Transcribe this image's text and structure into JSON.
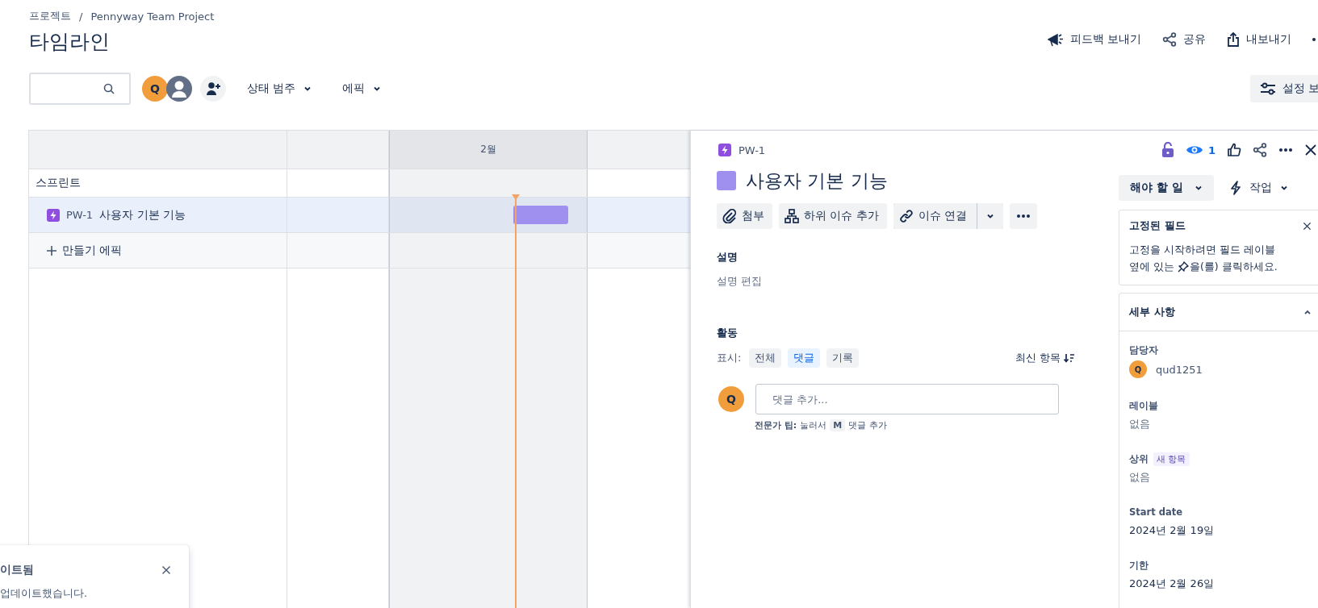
{
  "breadcrumb": {
    "items": [
      "프로젝트",
      "Pennyway Team Project"
    ],
    "separator": "/"
  },
  "page_title": "타임라인",
  "header_actions": [
    {
      "kind": "feedback",
      "label": "피드백 보내기"
    },
    {
      "kind": "share",
      "label": "공유"
    },
    {
      "kind": "export",
      "label": "내보내기"
    },
    {
      "kind": "more"
    }
  ],
  "toolbar": {
    "avatars": [
      {
        "kind": "letter",
        "initial": "Q"
      },
      {
        "kind": "silhouette"
      }
    ],
    "filters": [
      "상태 범주",
      "에픽"
    ],
    "view_settings": "설정 보"
  },
  "timeline": {
    "columns": [
      {
        "kind": "blank",
        "current": false
      },
      {
        "kind": "month",
        "label": "2월",
        "current": true
      }
    ],
    "rows": [
      {
        "kind": "sprint",
        "label": "스프린트"
      },
      {
        "kind": "epic",
        "key": "PW-1",
        "title": "사용자 기본 기능",
        "selected": true,
        "color": "#9f8fef"
      },
      {
        "kind": "create",
        "label": "만들기 에픽"
      }
    ]
  },
  "toast": {
    "title": "이트됨",
    "message": "업데이트했습니다."
  },
  "issue": {
    "key": "PW-1",
    "title": "사용자 기본 기능",
    "color": "#9f8fef",
    "watchers": "1",
    "actions": [
      {
        "kind": "attach",
        "label": "첨부"
      },
      {
        "kind": "child",
        "label": "하위 이슈 추가"
      },
      {
        "kind": "link",
        "label": "이슈 연결"
      },
      {
        "kind": "more"
      }
    ],
    "description": {
      "label": "설명",
      "placeholder": "설명 편집"
    },
    "activity": {
      "label": "활동",
      "show_label": "표시:",
      "filters": [
        {
          "label": "전체",
          "selected": false
        },
        {
          "label": "댓글",
          "selected": true
        },
        {
          "label": "기록",
          "selected": false
        }
      ],
      "sort": "최신 항목",
      "avatar": "Q",
      "comment_placeholder": "댓글 추가...",
      "tip": {
        "prefix": "전문가 팁:",
        "before": "눌러서",
        "key": "M",
        "after": "댓글 추가"
      }
    },
    "status": "해야 할 일",
    "automation": "작업",
    "pinned": {
      "title": "고정된 필드",
      "line1": "고정을 시작하려면 필드 레이블",
      "before": "옆에 있는",
      "after": "을(를) 클릭하세요."
    },
    "details": {
      "title": "세부 사항",
      "expanded": true,
      "fields": [
        {
          "kind": "user",
          "label": "담당자",
          "initial": "Q",
          "value": "qud1251"
        },
        {
          "kind": "text",
          "label": "레이블",
          "value": "없음"
        },
        {
          "kind": "text",
          "label": "상위",
          "badge": "새 항목",
          "value": "없음"
        },
        {
          "kind": "text",
          "label": "Start date",
          "value": "2024년 2월 19일"
        },
        {
          "kind": "text",
          "label": "기한",
          "value": "2024년 2월 26일"
        }
      ]
    }
  }
}
